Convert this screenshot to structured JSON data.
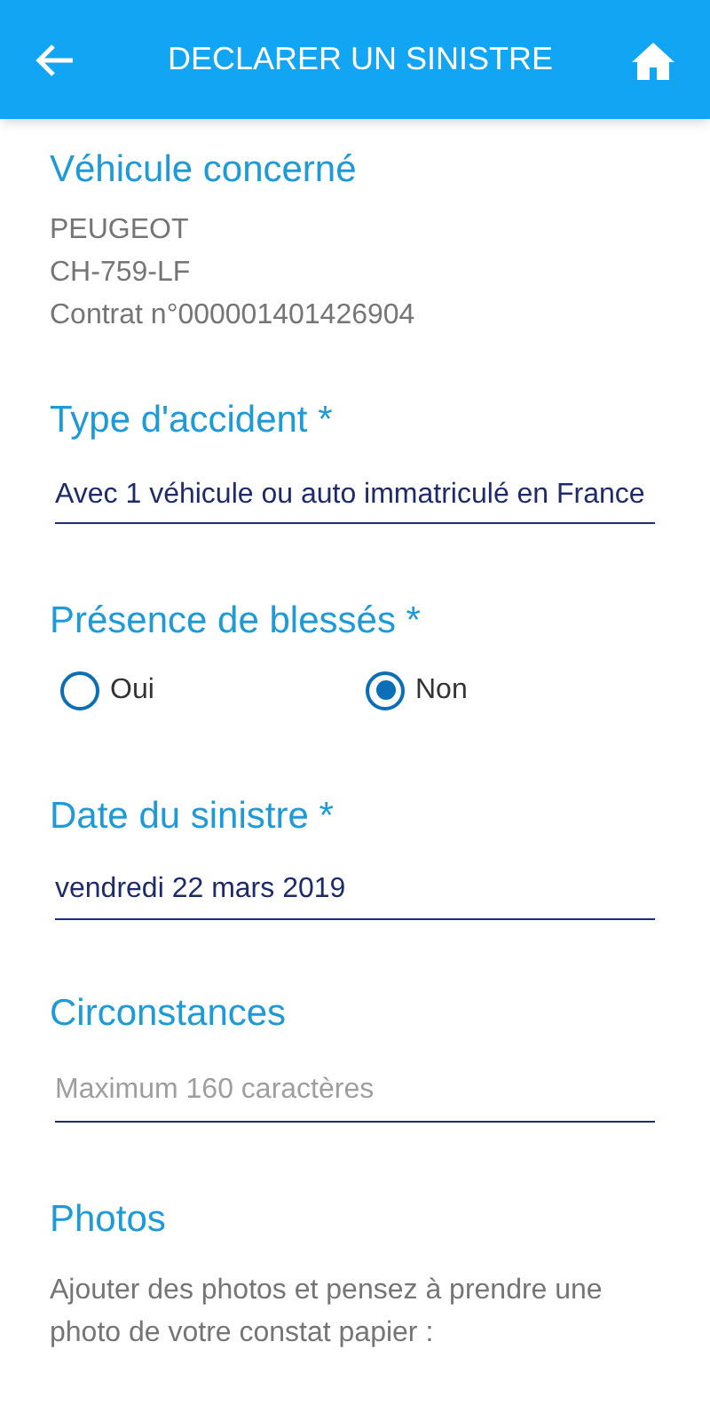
{
  "header": {
    "title": "DECLARER UN SINISTRE"
  },
  "vehicle": {
    "title": "Véhicule concerné",
    "lines": [
      "PEUGEOT",
      "CH-759-LF",
      "Contrat n°000001401426904"
    ]
  },
  "accident_type": {
    "title": "Type d'accident *",
    "value": "Avec 1 véhicule ou auto immatriculé en France"
  },
  "injuries": {
    "title": "Présence de blessés *",
    "options": [
      {
        "label": "Oui",
        "selected": false
      },
      {
        "label": "Non",
        "selected": true
      }
    ]
  },
  "date": {
    "title": "Date du sinistre *",
    "value": "vendredi 22 mars 2019"
  },
  "circumstances": {
    "title": "Circonstances",
    "placeholder": "Maximum 160 caractères"
  },
  "photos": {
    "title": "Photos",
    "text": "Ajouter des photos et pensez à prendre une photo de votre constat papier :"
  }
}
